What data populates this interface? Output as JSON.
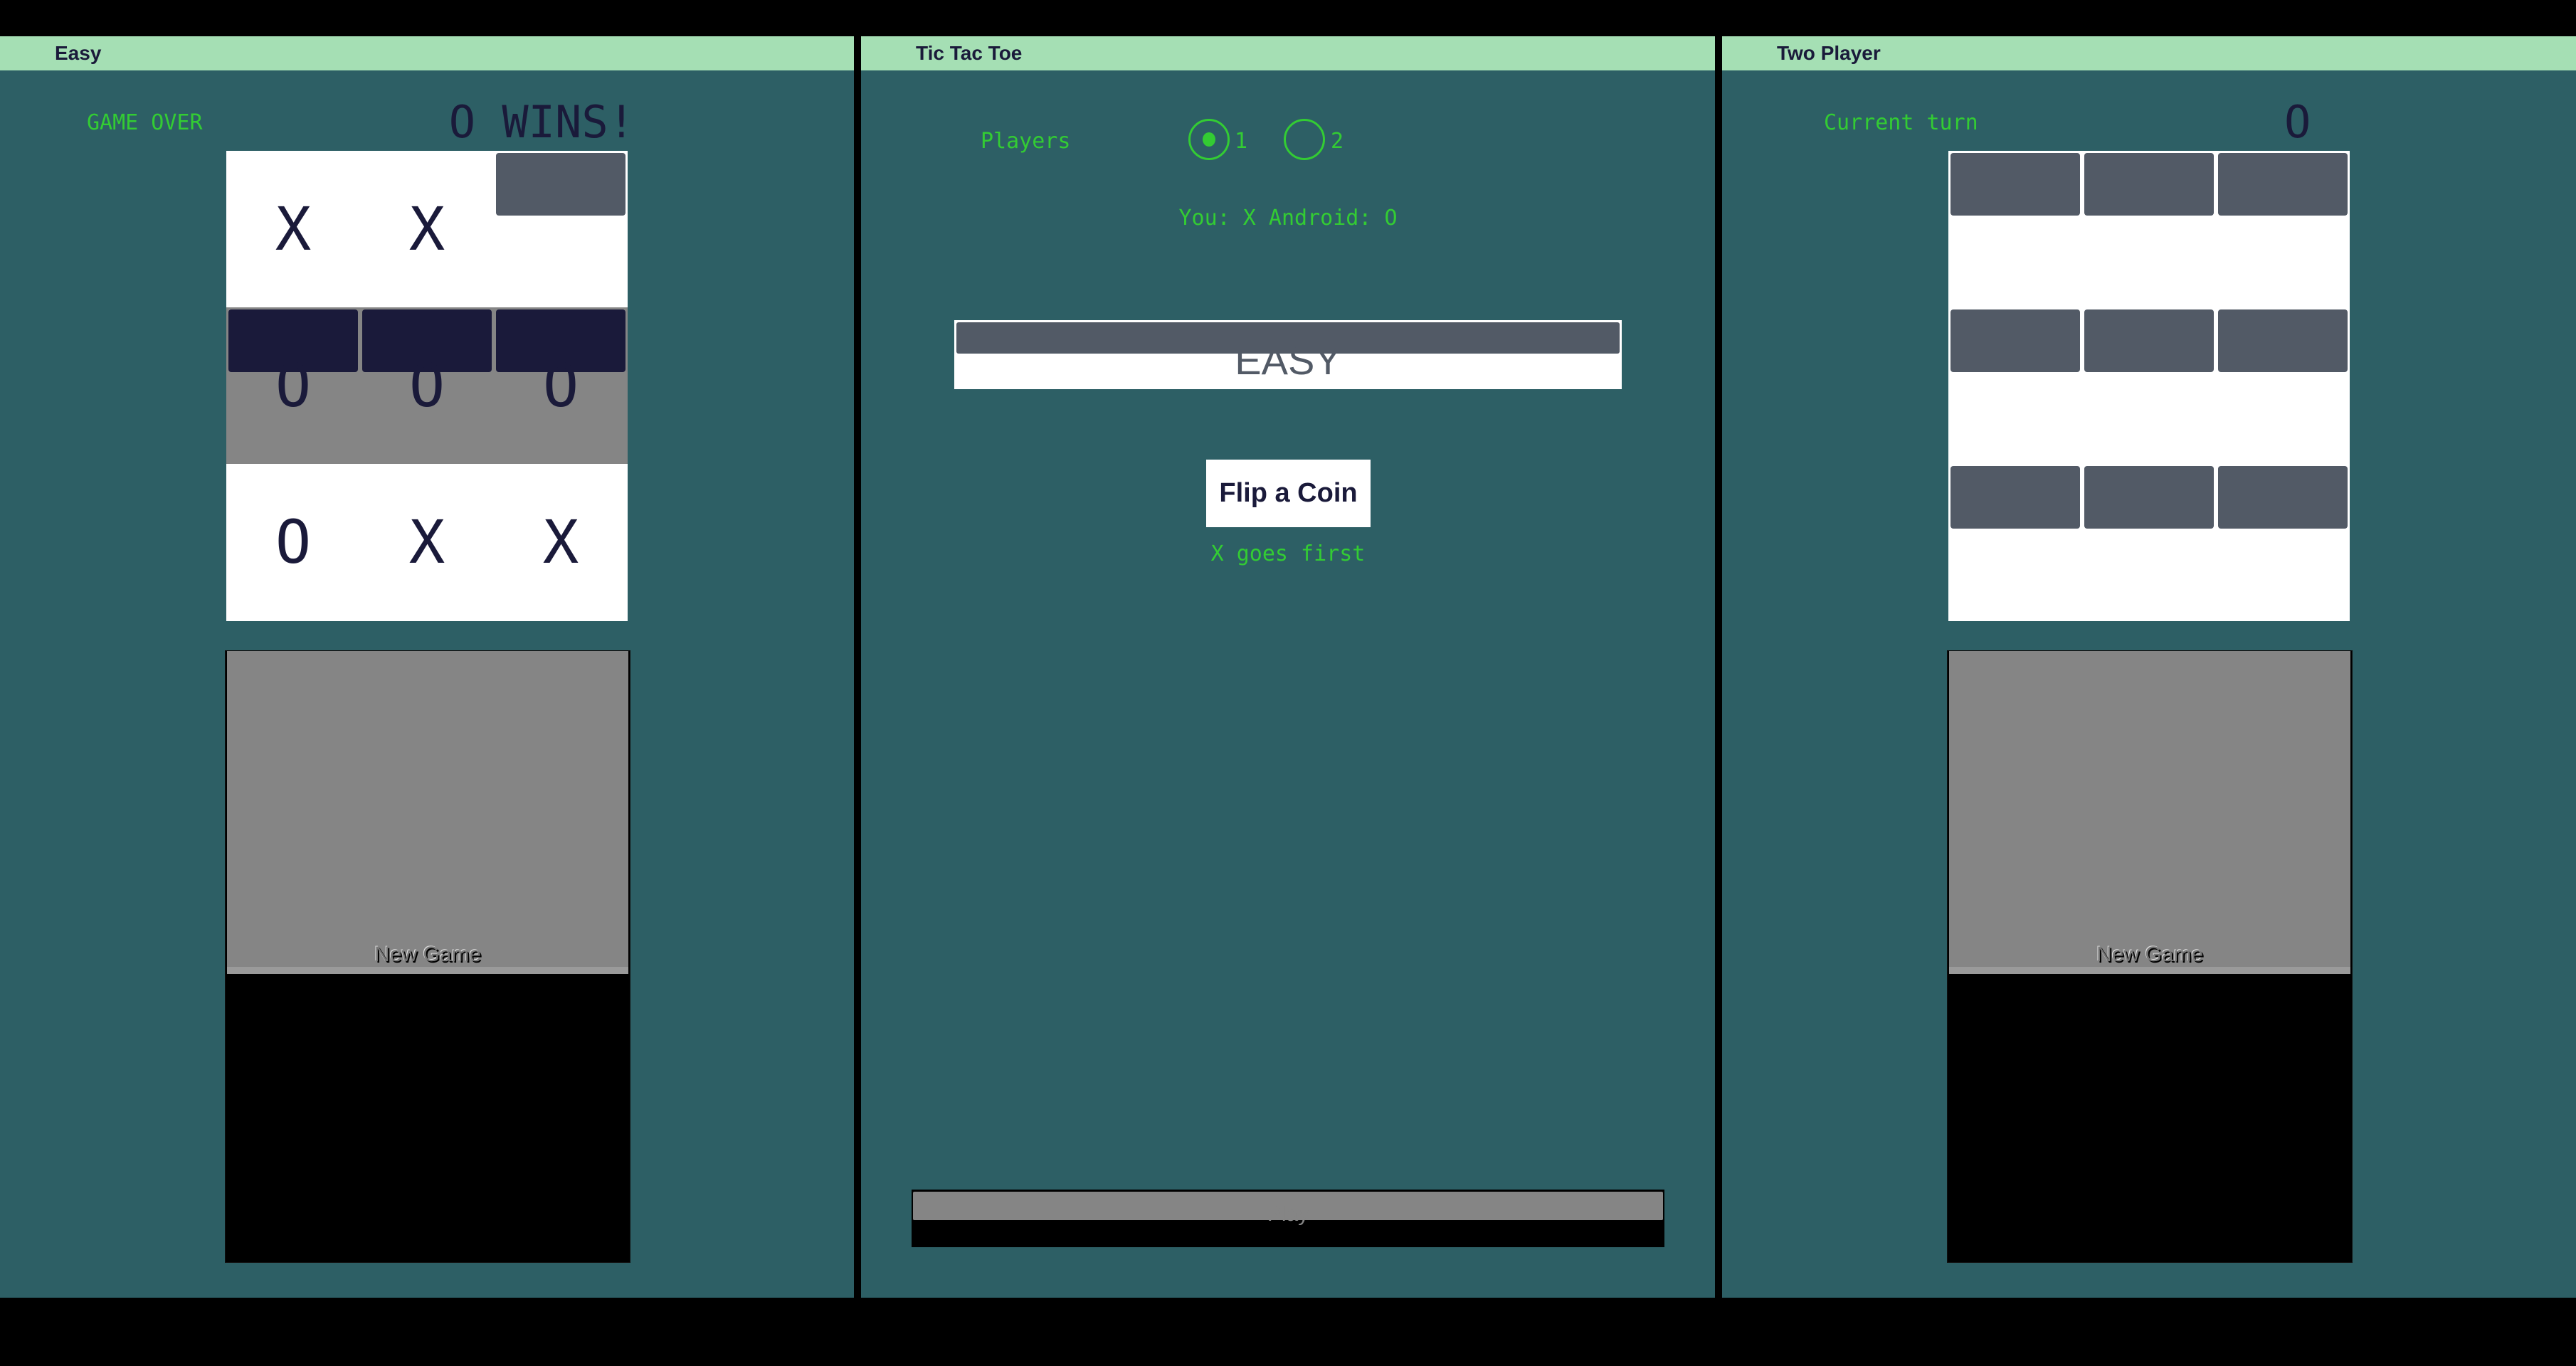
{
  "colors": {
    "panel_bg": "#2d5f65",
    "header_bg": "#a5dfb4",
    "accent_green": "#33cc33",
    "mark": "#1a1a3a",
    "highlight_row": "#858585",
    "win_block": "#1a1a3a",
    "empty_block": "#525a66"
  },
  "easy": {
    "title": "Easy",
    "status": "GAME OVER",
    "result": "O WINS!",
    "board": [
      [
        "X",
        "X",
        ""
      ],
      [
        "O",
        "O",
        "O"
      ],
      [
        "O",
        "X",
        "X"
      ]
    ],
    "winning_row": 1,
    "new_game_label": "New Game"
  },
  "main": {
    "title": "Tic Tac Toe",
    "players_label": "Players",
    "player_options": [
      "1",
      "2"
    ],
    "selected_players": "1",
    "assignment": "You: X Android: O",
    "difficulty": "EASY",
    "flip_label": "Flip a Coin",
    "flip_result": "X goes first",
    "play_label": "Play"
  },
  "two": {
    "title": "Two Player",
    "turn_label": "Current turn",
    "turn_value": "O",
    "board": [
      [
        "",
        "",
        ""
      ],
      [
        "",
        "",
        ""
      ],
      [
        "",
        "",
        ""
      ]
    ],
    "new_game_label": "New Game"
  }
}
